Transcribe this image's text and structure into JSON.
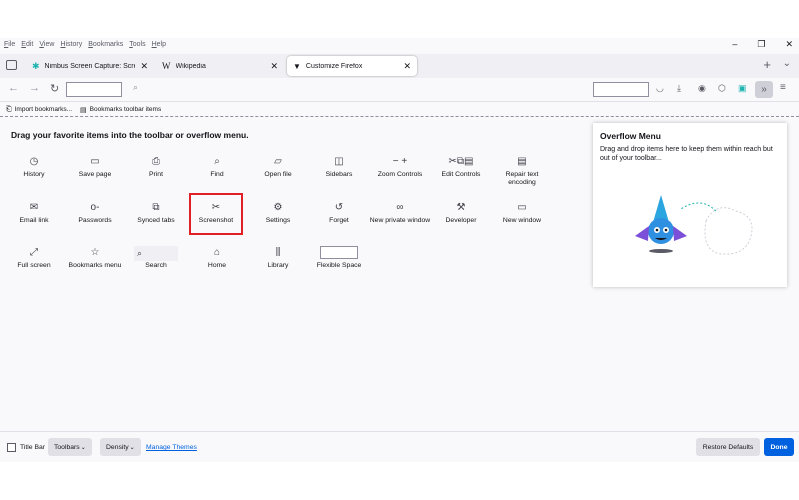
{
  "menubar": {
    "items": [
      "File",
      "Edit",
      "View",
      "History",
      "Bookmarks",
      "Tools",
      "Help"
    ]
  },
  "window_controls": {
    "minimize": "–",
    "restore": "❐",
    "close": "✕"
  },
  "tabs": [
    {
      "title": "Nimbus Screen Capture: Screens",
      "icon": "nimbus-icon"
    },
    {
      "title": "Wikipedia",
      "icon": "wikipedia-icon"
    },
    {
      "title": "Customize Firefox",
      "icon": "brush-icon",
      "active": true
    }
  ],
  "bookmarks_bar": {
    "import": "Import bookmarks...",
    "toolbar_items": "Bookmarks toolbar items"
  },
  "customize": {
    "heading": "Drag your favorite items into the toolbar or overflow menu.",
    "items": [
      {
        "label": "History",
        "icon": "clock-icon"
      },
      {
        "label": "Save page",
        "icon": "folder-icon"
      },
      {
        "label": "Print",
        "icon": "printer-icon"
      },
      {
        "label": "Find",
        "icon": "search-icon"
      },
      {
        "label": "Open file",
        "icon": "open-folder-icon"
      },
      {
        "label": "Sidebars",
        "icon": "sidebar-icon"
      },
      {
        "label": "Zoom Controls",
        "icon": "zoom-icon"
      },
      {
        "label": "Edit Controls",
        "icon": "edit-icon"
      },
      {
        "label": "Repair text encoding",
        "icon": "encoding-icon"
      },
      {
        "label": "Email link",
        "icon": "mail-icon"
      },
      {
        "label": "Passwords",
        "icon": "key-icon"
      },
      {
        "label": "Synced tabs",
        "icon": "synced-tabs-icon"
      },
      {
        "label": "Screenshot",
        "icon": "scissors-icon"
      },
      {
        "label": "Settings",
        "icon": "gear-icon"
      },
      {
        "label": "Forget",
        "icon": "forget-icon"
      },
      {
        "label": "New private window",
        "icon": "mask-icon"
      },
      {
        "label": "Developer",
        "icon": "wrench-icon"
      },
      {
        "label": "New window",
        "icon": "window-icon"
      },
      {
        "label": "Full screen",
        "icon": "fullscreen-icon"
      },
      {
        "label": "Bookmarks menu",
        "icon": "bookmark-star-icon"
      },
      {
        "label": "Search",
        "icon": "search-icon"
      },
      {
        "label": "Home",
        "icon": "home-icon"
      },
      {
        "label": "Library",
        "icon": "library-icon"
      },
      {
        "label": "Flexible Space",
        "icon": ""
      }
    ]
  },
  "overflow_panel": {
    "title": "Overflow Menu",
    "description": "Drag and drop items here to keep them within reach but out of your toolbar..."
  },
  "footer": {
    "title_bar": "Title Bar",
    "toolbars": "Toolbars",
    "density": "Density",
    "manage_themes": "Manage Themes",
    "restore_defaults": "Restore Defaults",
    "done": "Done"
  },
  "colors": {
    "accent": "#0061e0",
    "highlight": "#e01f26"
  }
}
